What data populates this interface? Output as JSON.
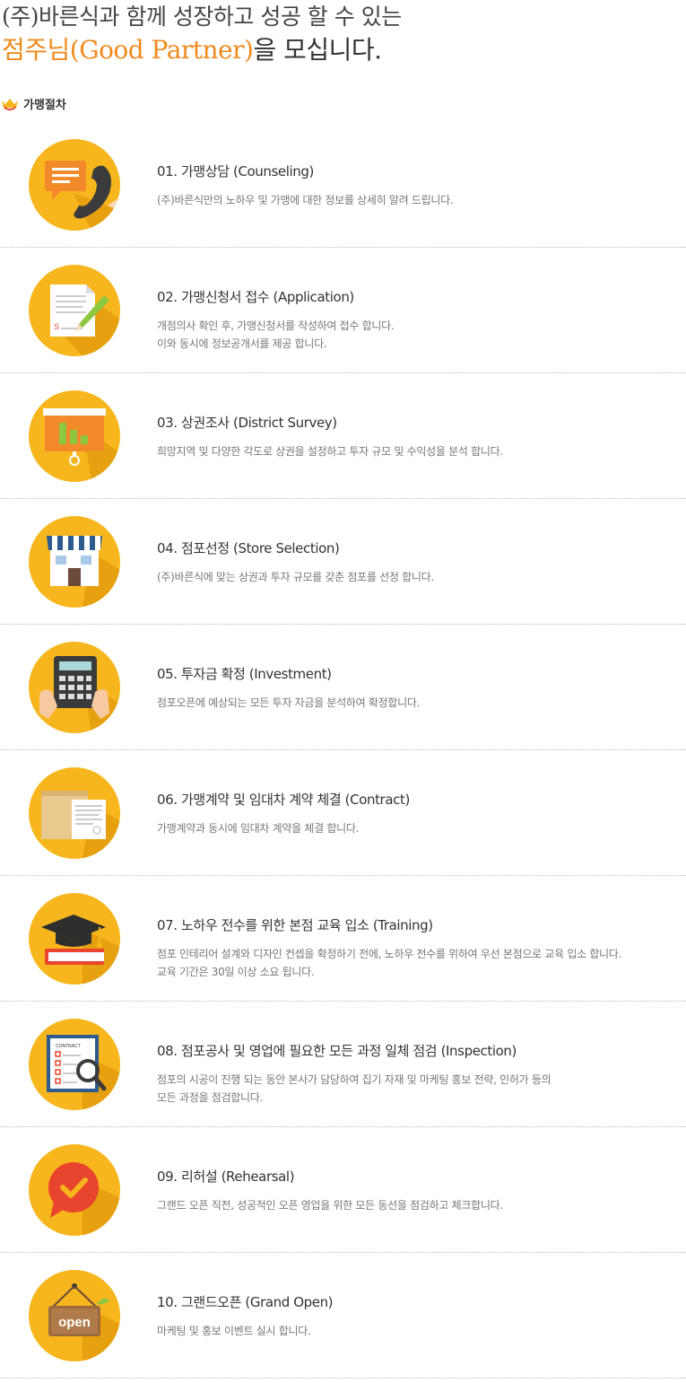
{
  "headline": {
    "line1": "(주)바른식과 함께 성장하고 성공 할 수 있는",
    "line2_accent": "점주님(Good Partner)",
    "line2_rest": "을 모십니다."
  },
  "section": {
    "title": "가맹절차",
    "icon": "crown-bullet-icon"
  },
  "colors": {
    "accent": "#f08a1d",
    "circle": "#f7b61d",
    "shadow": "#e6a010"
  },
  "steps": [
    {
      "title": "01. 가맹상담 (Counseling)",
      "desc": [
        "(주)바른식만의 노하우 및 가맹에 대한 정보를 상세히 알려 드립니다."
      ],
      "icon": "phone-chat-icon"
    },
    {
      "title": "02. 가맹신청서 접수 (Application)",
      "desc": [
        "개점의사 확인 후, 가맹신청서를 작성하여 접수 합니다.",
        "이와 동시에 정보공개서를 제공 합니다."
      ],
      "icon": "document-pen-icon"
    },
    {
      "title": "03. 상권조사 (District Survey)",
      "desc": [
        "희망지역 및 다양한 각도로 상권을 설정하고 투자 규모 및 수익성을 분석 합니다."
      ],
      "icon": "presentation-board-icon"
    },
    {
      "title": "04. 점포선정 (Store Selection)",
      "desc": [
        "(주)바른식에 맞는 상권과 투자 규모를 갖춘 점포를 선정 합니다."
      ],
      "icon": "storefront-icon"
    },
    {
      "title": "05. 투자금 확정 (Investment)",
      "desc": [
        "점포오픈에 예상되는 모든 투자 자금을 분석하여 확정합니다."
      ],
      "icon": "calculator-icon"
    },
    {
      "title": "06. 가맹계약 및 임대차 계약 체결 (Contract)",
      "desc": [
        "가맹계약과 동시에 임대차 계약을 체결 합니다."
      ],
      "icon": "contract-envelope-icon"
    },
    {
      "title": "07. 노하우 전수를 위한 본점 교육 입소 (Training)",
      "desc": [
        "점포 인테리어 설계와 디자인 컨셉을 확정하기 전에, 노하우 전수를 위하여 우선 본점으로 교육 입소 합니다.",
        "교육 기간은 30일 이상 소요 됩니다."
      ],
      "icon": "graduation-cap-icon"
    },
    {
      "title": "08. 점포공사 및 영업에 필요한 모든 과정 일체 점검 (Inspection)",
      "desc": [
        "점포의 시공이 진행 되는 동안 본사가 담당하여 집기 자재 및 마케팅 홍보 전략, 인허가 등의",
        "모든 과정을 점검합니다."
      ],
      "icon": "contract-magnifier-icon",
      "icon_text": "CONTRACT"
    },
    {
      "title": "09. 리허설 (Rehearsal)",
      "desc": [
        "그랜드 오픈 직전, 성공적인 오픈 영업을 위한 모든 동선을 점검하고 체크합니다."
      ],
      "icon": "speech-check-icon"
    },
    {
      "title": "10. 그랜드오픈 (Grand Open)",
      "desc": [
        "마케팅 및 홍보 이벤트 실시 합니다."
      ],
      "icon": "open-sign-icon",
      "icon_text": "open"
    }
  ]
}
